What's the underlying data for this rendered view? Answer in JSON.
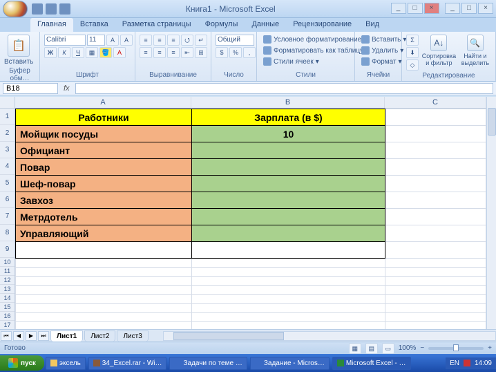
{
  "window": {
    "title": "Книга1 - Microsoft Excel",
    "min": "_",
    "max": "□",
    "close": "×",
    "doc_min": "_",
    "doc_max": "□",
    "doc_close": "×"
  },
  "tabs": {
    "home": "Главная",
    "insert": "Вставка",
    "layout": "Разметка страницы",
    "formulas": "Формулы",
    "data": "Данные",
    "review": "Рецензирование",
    "view": "Вид"
  },
  "ribbon": {
    "clipboard": {
      "label": "Буфер обм…",
      "paste": "Вставить"
    },
    "font": {
      "label": "Шрифт",
      "name": "Calibri",
      "size": "11"
    },
    "align": {
      "label": "Выравнивание"
    },
    "number": {
      "label": "Число",
      "format": "Общий"
    },
    "styles": {
      "label": "Стили",
      "cond": "Условное форматирование",
      "table": "Форматировать как таблицу",
      "cell": "Стили ячеек"
    },
    "cells": {
      "label": "Ячейки",
      "insert": "Вставить",
      "delete": "Удалить",
      "format": "Формат"
    },
    "editing": {
      "label": "Редактирование",
      "sort": "Сортировка и фильтр",
      "find": "Найти и выделить"
    }
  },
  "namebox": "B18",
  "fx_label": "fx",
  "columns": {
    "A": "A",
    "B": "B",
    "C": "C"
  },
  "table": {
    "h1": "Работники",
    "h2": "Зарплата (в $)",
    "rows": [
      {
        "name": "Мойщик посуды",
        "val": "10"
      },
      {
        "name": "Официант",
        "val": ""
      },
      {
        "name": "Повар",
        "val": ""
      },
      {
        "name": "Шеф-повар",
        "val": ""
      },
      {
        "name": "Завхоз",
        "val": ""
      },
      {
        "name": "Метрдотель",
        "val": ""
      },
      {
        "name": "Управляющий",
        "val": ""
      }
    ]
  },
  "sheets": {
    "s1": "Лист1",
    "s2": "Лист2",
    "s3": "Лист3"
  },
  "status": {
    "ready": "Готово",
    "zoom": "100%"
  },
  "taskbar": {
    "start": "пуск",
    "items": [
      "эксель",
      "34_Excel.rar - Wi…",
      "Задачи по теме …",
      "Задание - Micros…",
      "Microsoft Excel - …"
    ],
    "lang": "EN",
    "time": "14:09"
  },
  "chart_data": {
    "type": "table",
    "title": "Зарплата (в $)",
    "columns": [
      "Работники",
      "Зарплата (в $)"
    ],
    "rows": [
      [
        "Мойщик посуды",
        10
      ],
      [
        "Официант",
        null
      ],
      [
        "Повар",
        null
      ],
      [
        "Шеф-повар",
        null
      ],
      [
        "Завхоз",
        null
      ],
      [
        "Метрдотель",
        null
      ],
      [
        "Управляющий",
        null
      ]
    ]
  }
}
